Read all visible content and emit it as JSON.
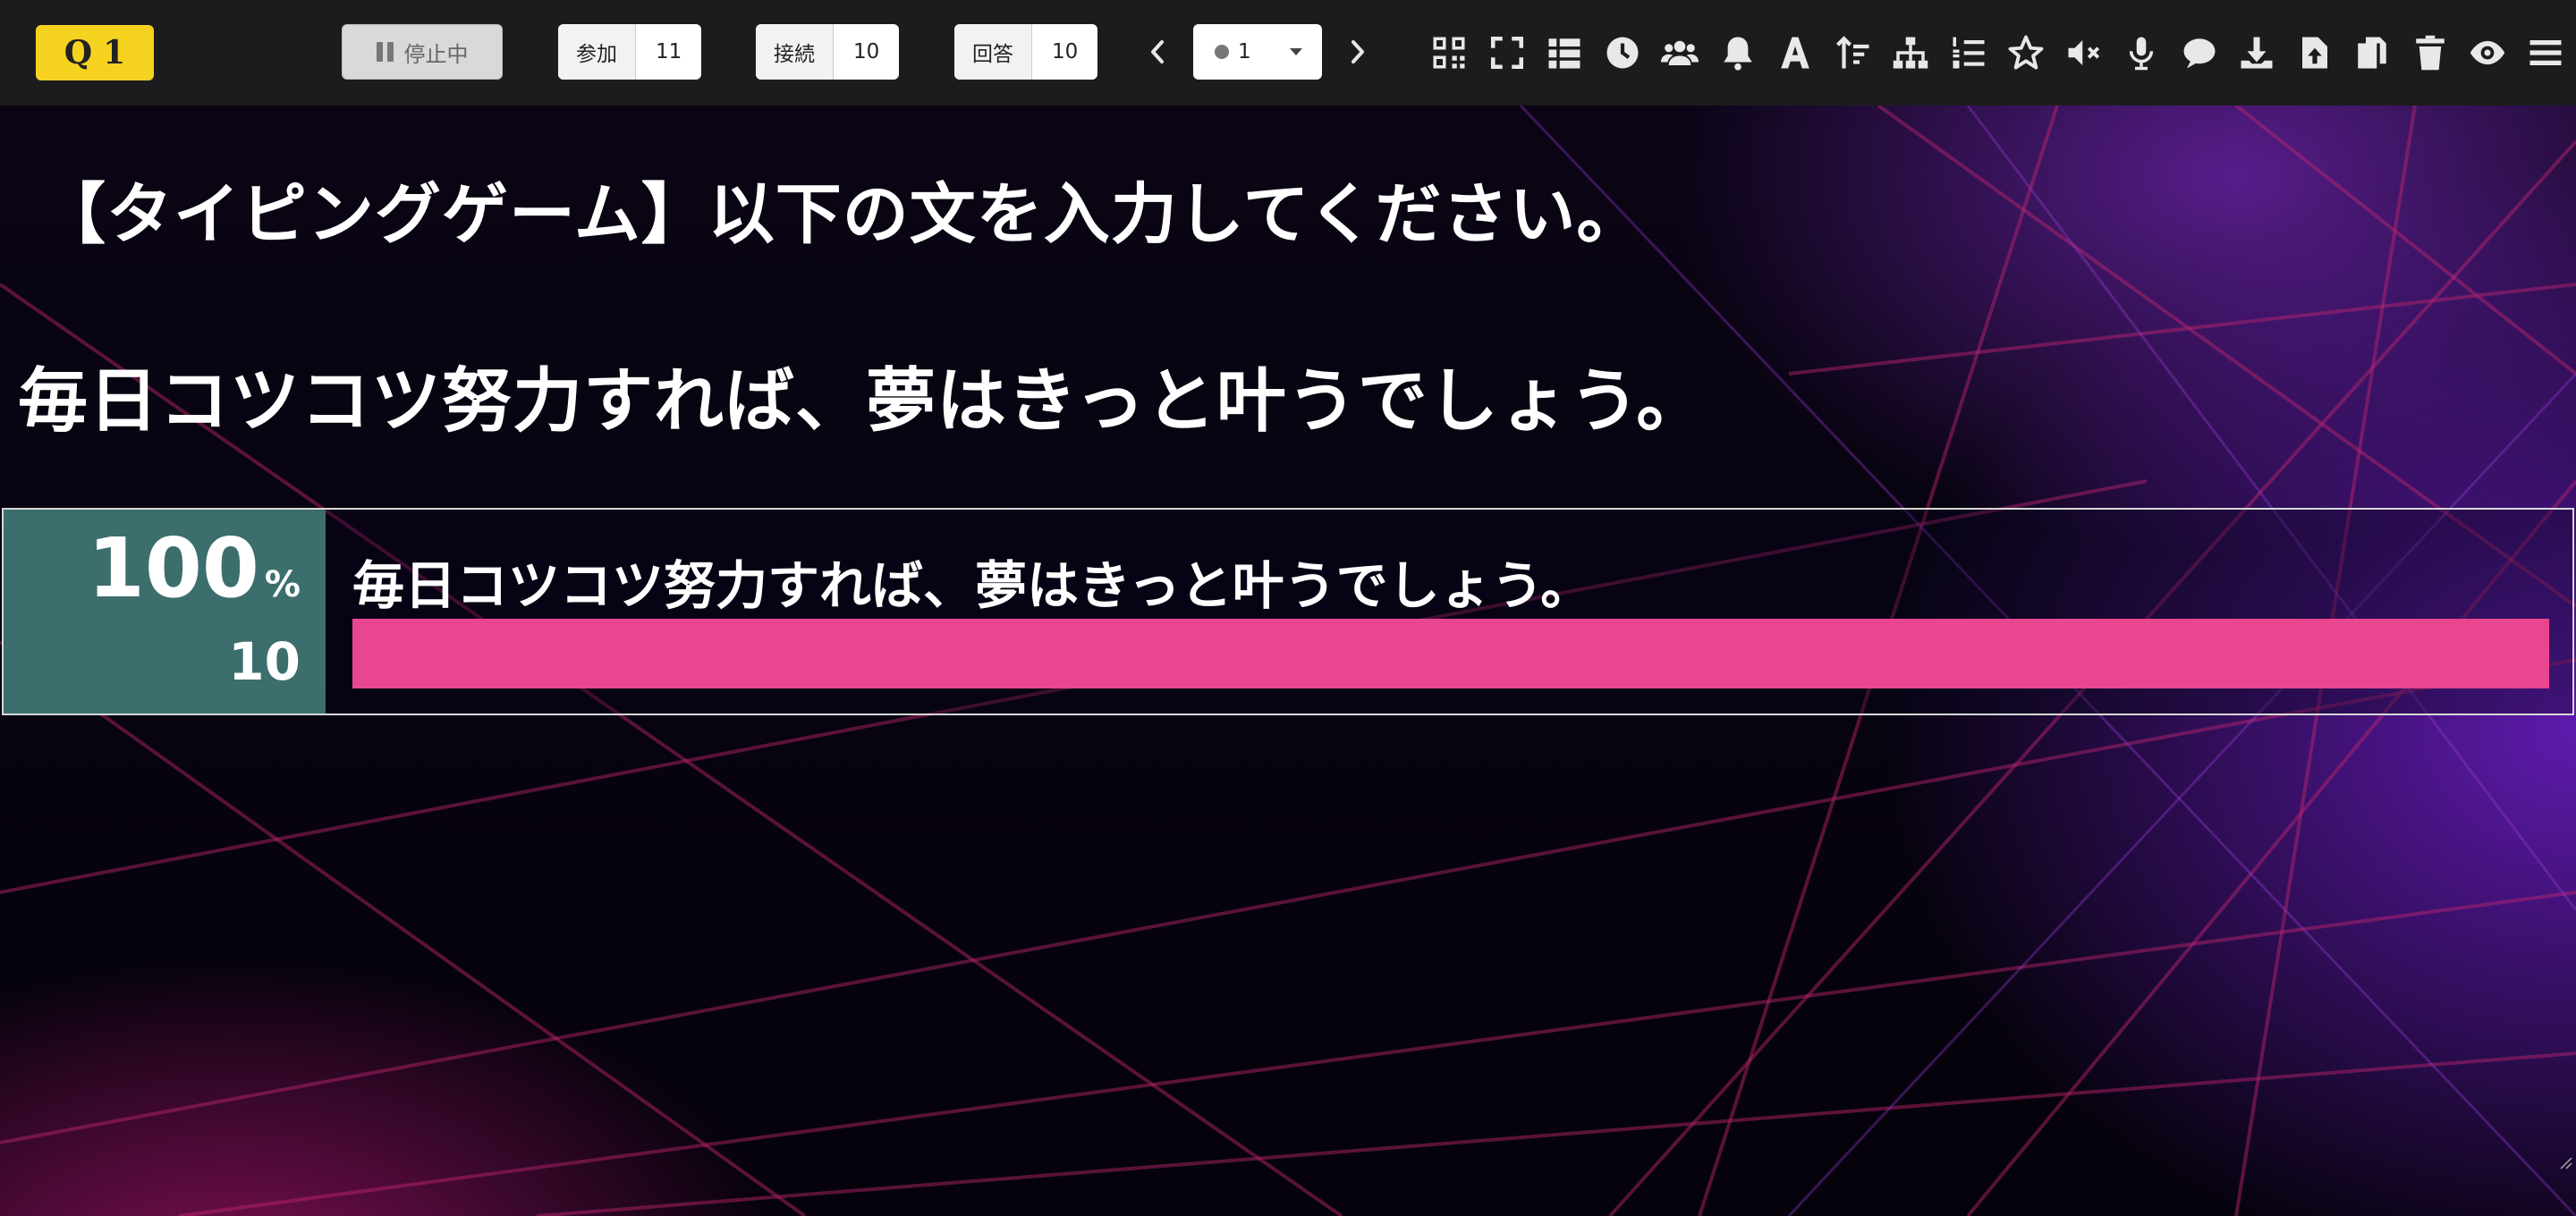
{
  "question": {
    "q_label": "Q",
    "q_number": "1"
  },
  "controls": {
    "status_label": "停止中",
    "stats": [
      {
        "label": "参加",
        "value": "11"
      },
      {
        "label": "接続",
        "value": "10"
      },
      {
        "label": "回答",
        "value": "10"
      }
    ],
    "page_value": "1"
  },
  "toolbar_icons": [
    "qr-code-icon",
    "fullscreen-icon",
    "table-icon",
    "clock-icon",
    "users-icon",
    "bell-icon",
    "font-icon",
    "sort-icon",
    "sitemap-icon",
    "numbered-list-icon",
    "star-icon",
    "mute-icon",
    "microphone-icon",
    "comment-icon",
    "download-icon",
    "upload-icon",
    "copy-icon",
    "trash-icon",
    "eye-icon",
    "menu-icon"
  ],
  "main": {
    "heading": "【タイピングゲーム】以下の文を入力してください。",
    "sentence": "毎日コツコツ努力すれば、夢はきっと叶うでしょう。"
  },
  "result": {
    "percent": "100",
    "percent_symbol": "%",
    "count": "10",
    "answer_text": "毎日コツコツ努力すれば、夢はきっと叶うでしょう。",
    "fill_fraction": 1.0
  },
  "colors": {
    "badge": "#f5d21f",
    "result_panel": "#3d6e6e",
    "bar": "#e8468e",
    "toolbar": "#1c1c1e"
  }
}
